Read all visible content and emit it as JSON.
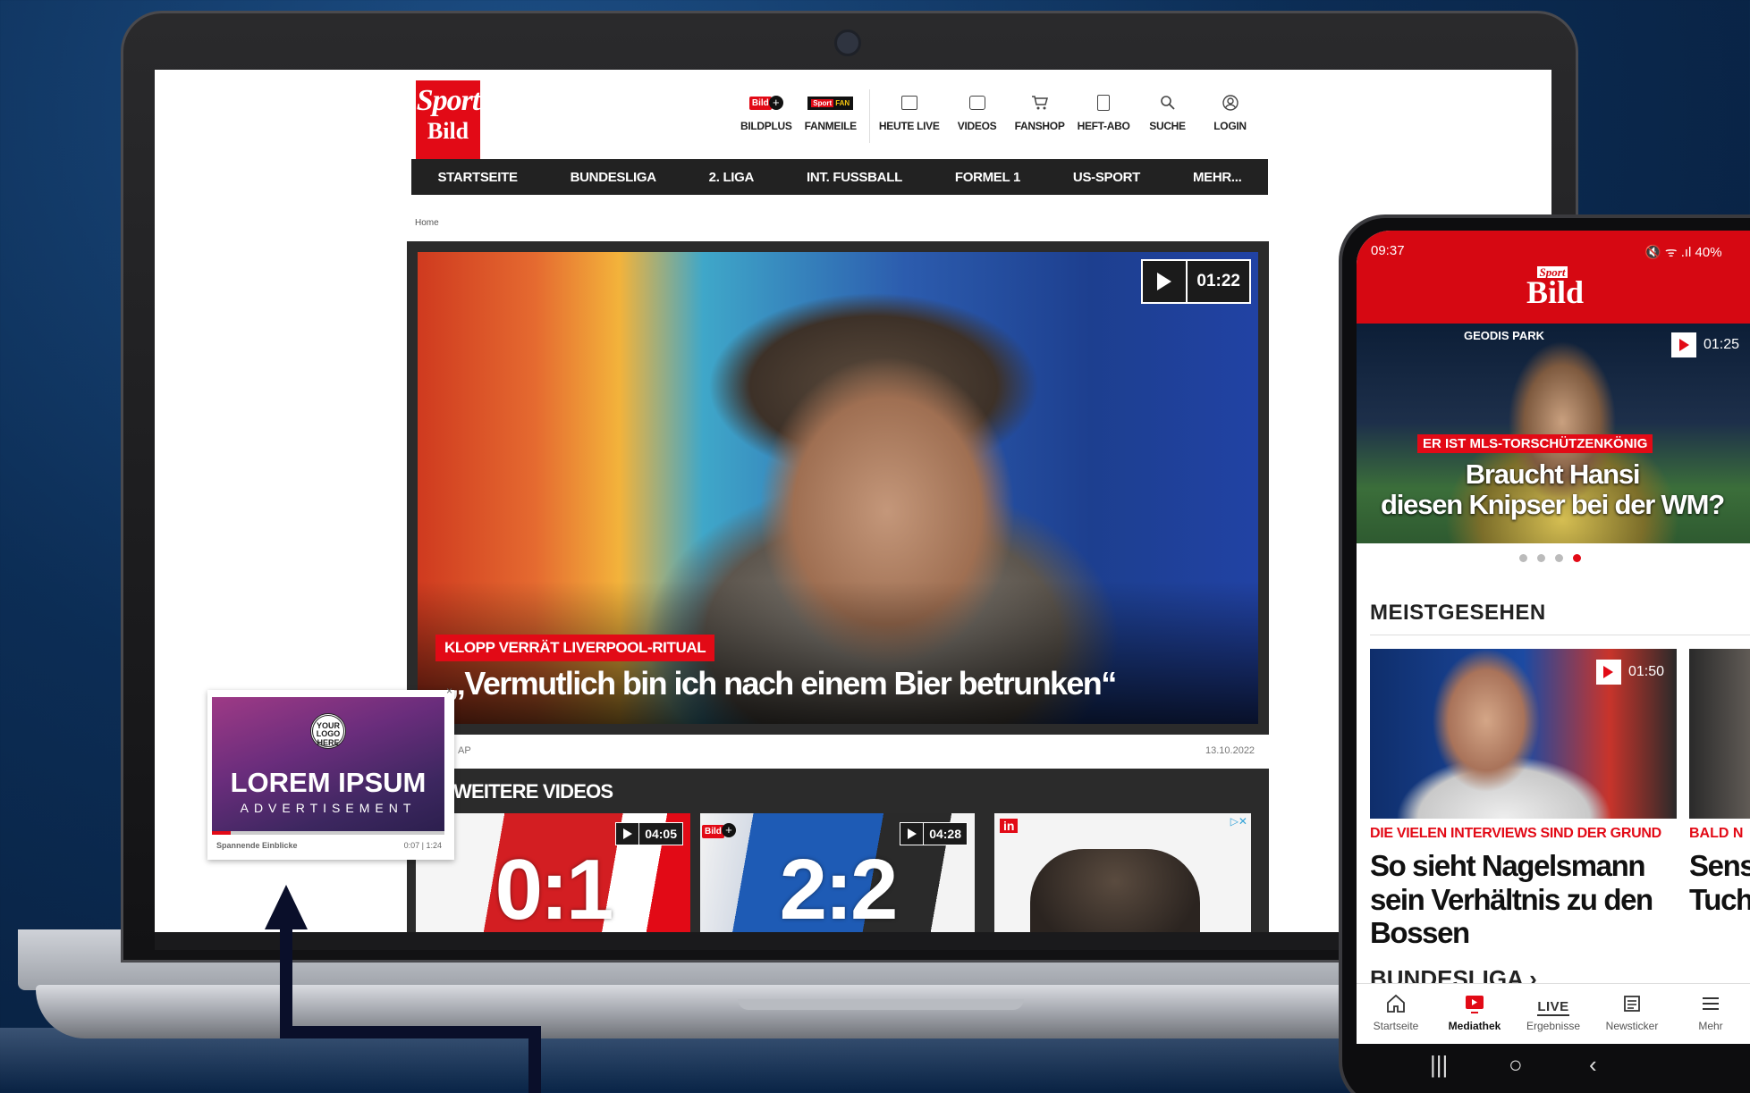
{
  "site": {
    "logo": {
      "line1": "Sport",
      "line2": "Bild"
    },
    "topnav": [
      {
        "key": "bildplus",
        "label": "BILDPLUS",
        "icon": "bildplus-icon"
      },
      {
        "key": "fanmeile",
        "label": "FANMEILE",
        "icon": "fanmeile-icon"
      },
      {
        "key": "heutelive",
        "label": "HEUTE LIVE",
        "icon": "calendar-icon"
      },
      {
        "key": "videos",
        "label": "VIDEOS",
        "icon": "video-icon"
      },
      {
        "key": "fanshop",
        "label": "FANSHOP",
        "icon": "cart-icon"
      },
      {
        "key": "heftabo",
        "label": "HEFT-ABO",
        "icon": "magazine-icon"
      },
      {
        "key": "suche",
        "label": "SUCHE",
        "icon": "search-icon"
      },
      {
        "key": "login",
        "label": "LOGIN",
        "icon": "user-icon"
      }
    ],
    "badges": {
      "bild": "Bild",
      "plus": "+",
      "fan": "FAN",
      "fan_sub": "MEILE",
      "sport": "Sport"
    },
    "mainnav": [
      "STARTSEITE",
      "BUNDESLIGA",
      "2. LIGA",
      "INT. FUSSBALL",
      "FORMEL 1",
      "US-SPORT",
      "MEHR..."
    ],
    "breadcrumb": "Home",
    "hero": {
      "duration": "01:22",
      "kicker": "KLOPP VERRÄT LIVERPOOL-RITUAL",
      "title": "„Vermutlich bin ich nach einem Bier betrunken“",
      "source": "AP",
      "date": "13.10.2022"
    },
    "more_videos": {
      "title": "WEITERE VIDEOS",
      "cards": [
        {
          "score": "0:1",
          "duration": "04:05"
        },
        {
          "score": "2:2",
          "duration": "04:28"
        }
      ],
      "ad": {
        "badge": "in",
        "choices": "▷✕"
      }
    }
  },
  "float_ad": {
    "logo_text": "YOUR LOGO HERE",
    "headline": "LOREM IPSUM",
    "subline": "ADVERTISEMENT",
    "caption": "Spannende Einblicke",
    "time": "0:07 | 1:24",
    "progress": 0.08,
    "close": "×"
  },
  "phone": {
    "status_time": "09:37",
    "status_right": "🔇 ᯤ .ıl 40%",
    "logo": {
      "line1": "Sport",
      "line2": "Bild"
    },
    "hero": {
      "venue": "GEODIS PARK",
      "duration": "01:25",
      "kicker": "ER IST MLS-TORSCHÜTZENKÖNIG",
      "title_line1": "Braucht Hansi",
      "title_line2": "diesen Knipser bei der WM?",
      "dots_total": 4,
      "active_dot": 4
    },
    "section_title": "MEISTGESEHEN",
    "cards": [
      {
        "duration": "01:50",
        "kicker": "DIE VIELEN INTERVIEWS SIND DER GRUND",
        "title": "So sieht Nagelsmann sein Verhältnis zu den Bossen"
      },
      {
        "kicker": "BALD N",
        "title": "Sensa\nTuche"
      }
    ],
    "section2": "BUNDESLIGA ›",
    "tabs": [
      {
        "label": "Startseite",
        "icon": "home-icon"
      },
      {
        "label": "Mediathek",
        "icon": "mediathek-icon",
        "active": true
      },
      {
        "label": "Ergebnisse",
        "icon": "live-icon",
        "icon_text": "LIVE"
      },
      {
        "label": "Newsticker",
        "icon": "newsticker-icon"
      },
      {
        "label": "Mehr",
        "icon": "menu-icon"
      }
    ],
    "navbar": {
      "recent": "|||",
      "home": "○",
      "back": "‹"
    }
  },
  "colors": {
    "accent": "#e20a16",
    "nav_bg": "#222222",
    "background": "#0c2d55"
  }
}
